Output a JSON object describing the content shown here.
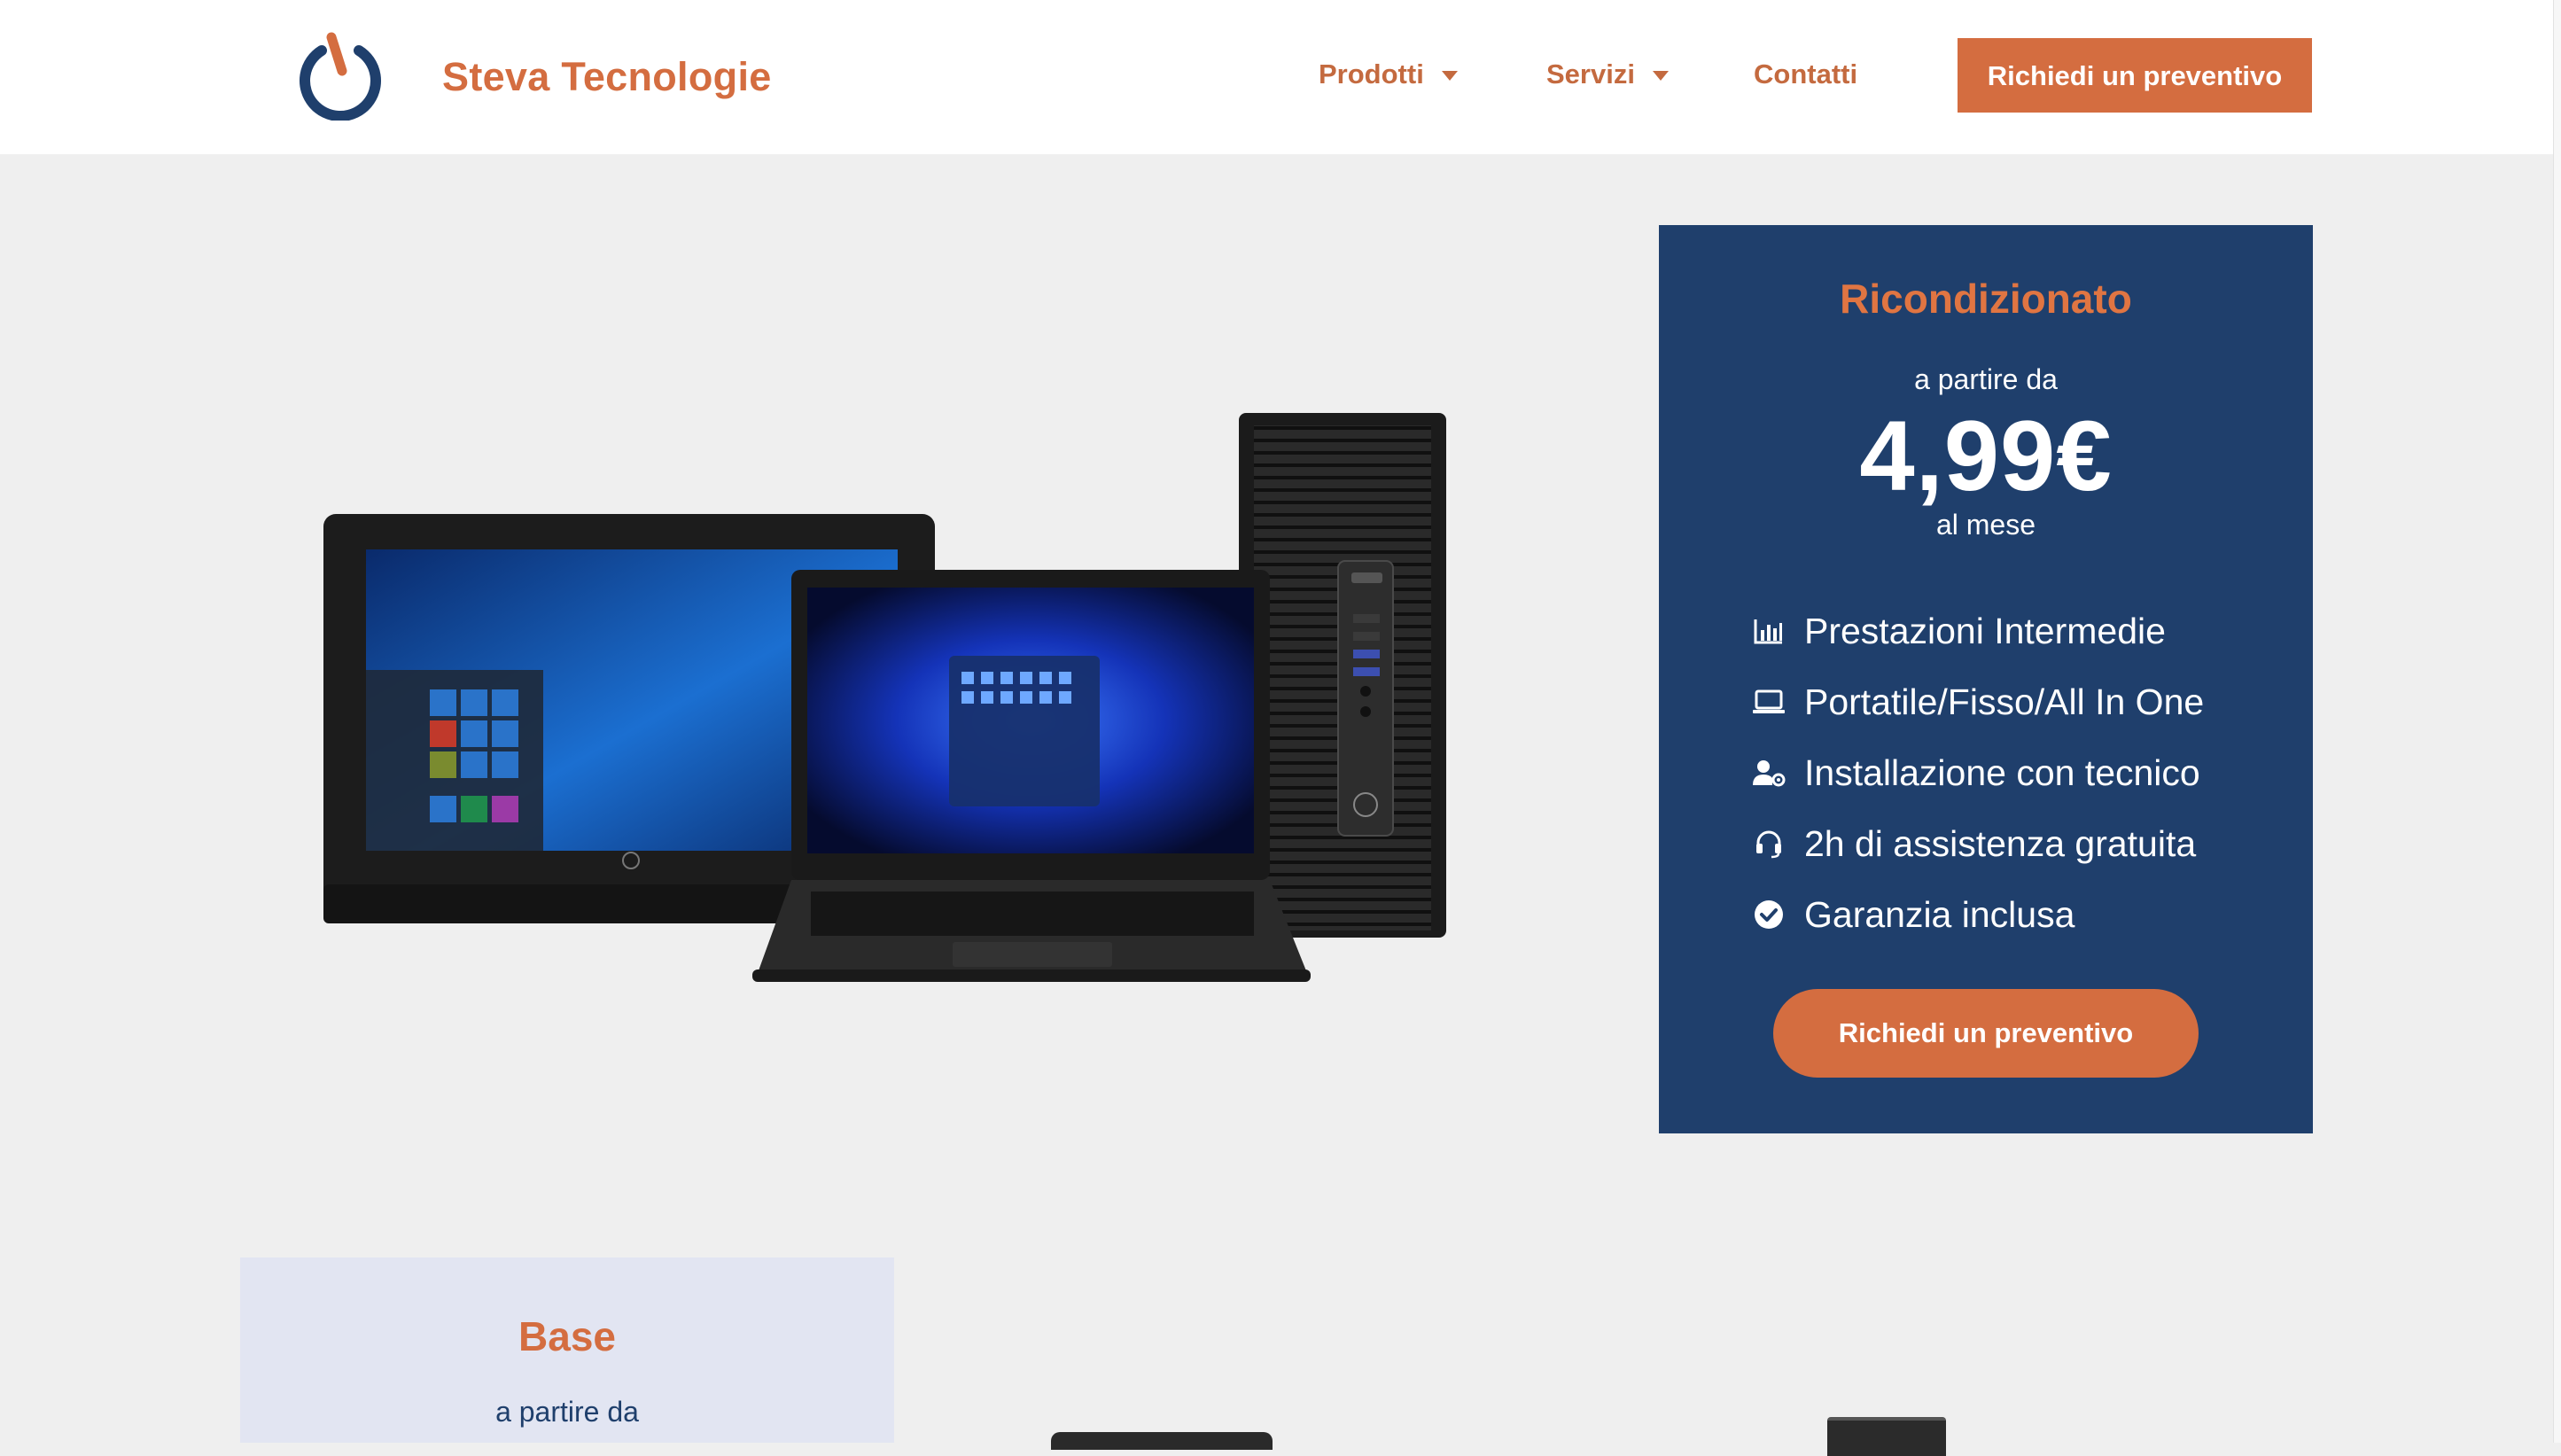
{
  "colors": {
    "accent": "#d46d40",
    "navy": "#1f3f6c",
    "header_bg": "#ffffff",
    "page_bg": "#efefef"
  },
  "header": {
    "brand": "Steva Tecnologie",
    "logo_icon": "power-icon",
    "nav": [
      {
        "label": "Prodotti",
        "has_dropdown": true
      },
      {
        "label": "Servizi",
        "has_dropdown": true
      },
      {
        "label": "Contatti",
        "has_dropdown": false
      }
    ],
    "cta_label": "Richiedi un preventivo"
  },
  "hero": {
    "image_alt": "computer-products-image",
    "card": {
      "title": "Ricondizionato",
      "from_label": "a partire da",
      "price": "4,99€",
      "per_label": "al mese",
      "features": [
        {
          "icon": "chart-bar-icon",
          "label": "Prestazioni Intermedie"
        },
        {
          "icon": "laptop-icon",
          "label": "Portatile/Fisso/All In One"
        },
        {
          "icon": "user-cog-icon",
          "label": "Installazione con tecnico"
        },
        {
          "icon": "headset-icon",
          "label": "2h di assistenza gratuita"
        },
        {
          "icon": "check-circle-icon",
          "label": "Garanzia inclusa"
        }
      ],
      "cta_label": "Richiedi un preventivo"
    }
  },
  "lower": {
    "base_card": {
      "title": "Base",
      "from_label": "a partire da"
    }
  }
}
